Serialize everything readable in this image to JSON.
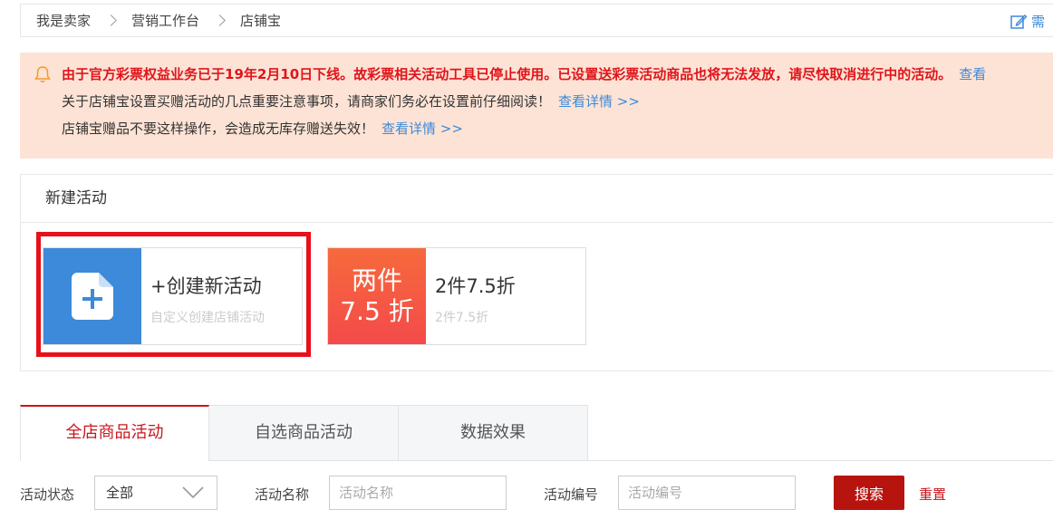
{
  "breadcrumb": {
    "items": [
      "我是卖家",
      "营销工作台",
      "店铺宝"
    ],
    "edit_label": "需"
  },
  "notice": {
    "line1": "由于官方彩票权益业务已于19年2月10日下线。故彩票相关活动工具已停止使用。已设置送彩票活动商品也将无法发放，请尽快取消进行中的活动。",
    "line1_link": "查看",
    "line2": "关于店铺宝设置买赠活动的几点重要注意事项，请商家们务必在设置前仔细阅读！",
    "line2_link": "查看详情 >>",
    "line3": "店铺宝赠品不要这样操作，会造成无库存赠送失效！",
    "line3_link": "查看详情 >>"
  },
  "new_activity": {
    "title": "新建活动",
    "create": {
      "title": "+创建新活动",
      "subtitle": "自定义创建店铺活动"
    },
    "promo": {
      "badge_line1": "两件",
      "badge_line2": "7.5 折",
      "title": "2件7.5折",
      "subtitle": "2件7.5折"
    }
  },
  "tabs": [
    "全店商品活动",
    "自选商品活动",
    "数据效果"
  ],
  "filter": {
    "status_label": "活动状态",
    "status_value": "全部",
    "name_label": "活动名称",
    "name_placeholder": "活动名称",
    "id_label": "活动编号",
    "id_placeholder": "活动编号",
    "search_label": "搜索",
    "reset_label": "重置"
  },
  "colors": {
    "accent_red": "#c8161d",
    "link_blue": "#3d8ad8",
    "notice_bg": "#fde3d5",
    "create_blue": "#3c8ad9"
  }
}
